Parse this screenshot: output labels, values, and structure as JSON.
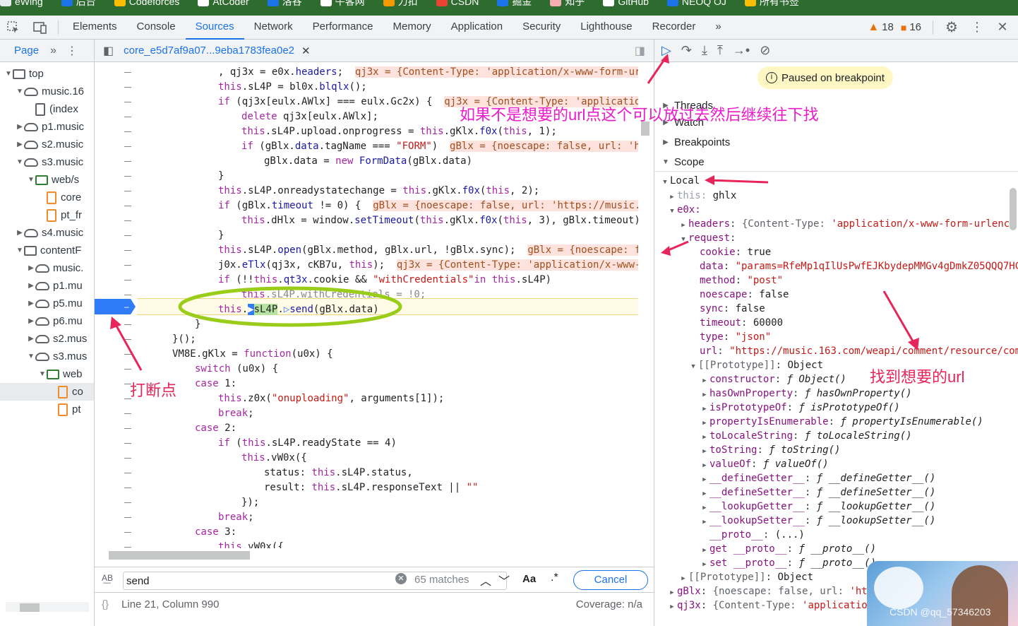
{
  "bookmarks": [
    "eWing",
    "后台",
    "Codeforces",
    "AtCoder",
    "洛谷",
    "牛客网",
    "力扣",
    "CSDN",
    "掘金",
    "知乎",
    "GitHub",
    "NEOQ OJ",
    "所有书签"
  ],
  "devtools_tabs": [
    "Elements",
    "Console",
    "Sources",
    "Network",
    "Performance",
    "Memory",
    "Application",
    "Security",
    "Lighthouse",
    "Recorder"
  ],
  "active_tab": "Sources",
  "more_tabs_glyph": "»",
  "errors_count": "18",
  "warnings_count": "16",
  "navigator": {
    "tab_label": "Page",
    "more_glyph": "»",
    "items": [
      {
        "label": "top",
        "icon": "frame"
      },
      {
        "label": "music.16",
        "icon": "cloud"
      },
      {
        "label": "(index",
        "icon": "file"
      },
      {
        "label": "p1.music",
        "icon": "cloud"
      },
      {
        "label": "s2.music",
        "icon": "cloud"
      },
      {
        "label": "s3.music",
        "icon": "cloud"
      },
      {
        "label": "web/s",
        "icon": "folder"
      },
      {
        "label": "core",
        "icon": "file-orange"
      },
      {
        "label": "pt_fr",
        "icon": "file-orange"
      },
      {
        "label": "s4.music",
        "icon": "cloud"
      },
      {
        "label": "contentF",
        "icon": "frame"
      },
      {
        "label": "music.",
        "icon": "cloud"
      },
      {
        "label": "p1.mu",
        "icon": "cloud"
      },
      {
        "label": "p5.mu",
        "icon": "cloud"
      },
      {
        "label": "p6.mu",
        "icon": "cloud"
      },
      {
        "label": "s2.mus",
        "icon": "cloud"
      },
      {
        "label": "s3.mus",
        "icon": "cloud"
      },
      {
        "label": "web",
        "icon": "folder"
      },
      {
        "label": "co",
        "icon": "file-orange"
      },
      {
        "label": "pt",
        "icon": "file-orange"
      }
    ]
  },
  "editor": {
    "file_tab": "core_e5d7af9a07...9eba1783fea0e2",
    "breakpoint_line_label": "–",
    "search": {
      "value": "send",
      "matches": "65 matches",
      "case_label": "Aa",
      "regex_label": ".*",
      "cancel_label": "Cancel"
    },
    "status": {
      "position": "Line 21, Column 990",
      "coverage": "Coverage: n/a"
    }
  },
  "debugger": {
    "paused_label": "Paused on breakpoint",
    "sections": {
      "threads": "Threads",
      "watch": "Watch",
      "breakpoints": "Breakpoints",
      "scope": "Scope"
    },
    "local_label": "Local"
  },
  "annotations": {
    "skip_hint": "如果不是想要的url点这个可以放过去然后继续往下找",
    "breakpoint_hint": "打断点",
    "found_hint": "找到想要的url"
  },
  "watermark": "CSDN @qq_57346203"
}
